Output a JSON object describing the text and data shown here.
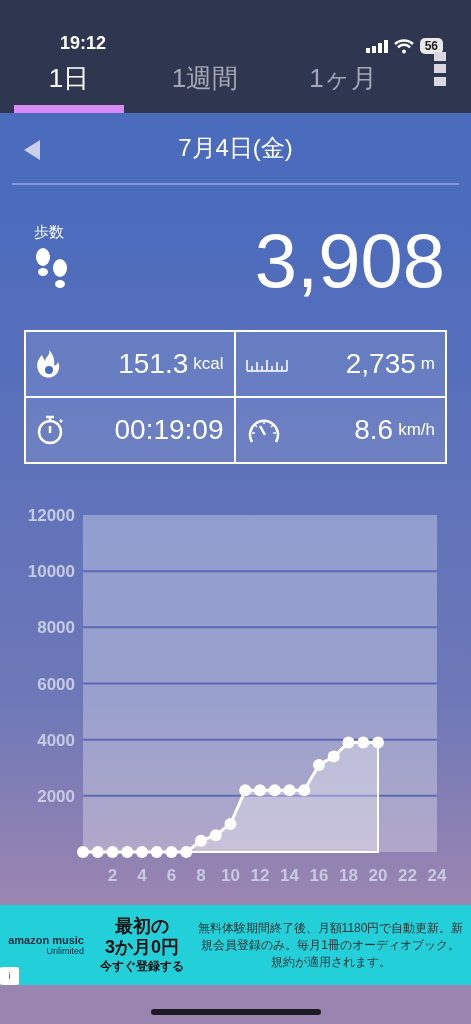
{
  "status_bar": {
    "time": "19:12",
    "battery": "56"
  },
  "tabs": [
    {
      "label": "1日",
      "selected": true
    },
    {
      "label": "1週間",
      "selected": false
    },
    {
      "label": "1ヶ月",
      "selected": false
    }
  ],
  "date_nav": {
    "date": "7月4日(金)"
  },
  "steps": {
    "label": "歩数",
    "value": "3,908"
  },
  "stats": [
    {
      "kind": "calories",
      "value": "151.3",
      "unit": "kcal"
    },
    {
      "kind": "distance",
      "value": "2,735",
      "unit": "m"
    },
    {
      "kind": "duration",
      "value": "00:19:09"
    },
    {
      "kind": "speed",
      "value": "8.6",
      "unit": "km/h"
    }
  ],
  "chart_data": {
    "type": "area",
    "x": [
      0,
      1,
      2,
      3,
      4,
      5,
      6,
      7,
      8,
      9,
      10,
      11,
      12,
      13,
      14,
      15,
      16,
      17,
      18,
      19,
      20
    ],
    "series": [
      {
        "color": "#ffffff",
        "values": [
          0,
          0,
          0,
          0,
          0,
          0,
          0,
          0,
          400,
          600,
          1000,
          2200,
          2200,
          2200,
          2200,
          2200,
          3100,
          3400,
          3900,
          3900,
          3900
        ]
      }
    ],
    "grid": true,
    "xlim": [
      0,
      24
    ],
    "ylim": [
      0,
      12000
    ],
    "xticks": [
      2,
      4,
      6,
      8,
      10,
      12,
      14,
      16,
      18,
      20,
      22,
      24
    ],
    "yticks": [
      2000,
      4000,
      6000,
      8000,
      10000,
      12000
    ]
  },
  "ad": {
    "logo": "amazon music",
    "logo_sub": "Unlimited",
    "headline": "最初の",
    "headline2": "3か月0円",
    "cta": "今すぐ登録する",
    "terms": "無料体験期間終了後、月額1180円で自動更新。新規会員登録のみ。毎月1冊のオーディオブック。規約が適用されます。",
    "info": "i"
  }
}
